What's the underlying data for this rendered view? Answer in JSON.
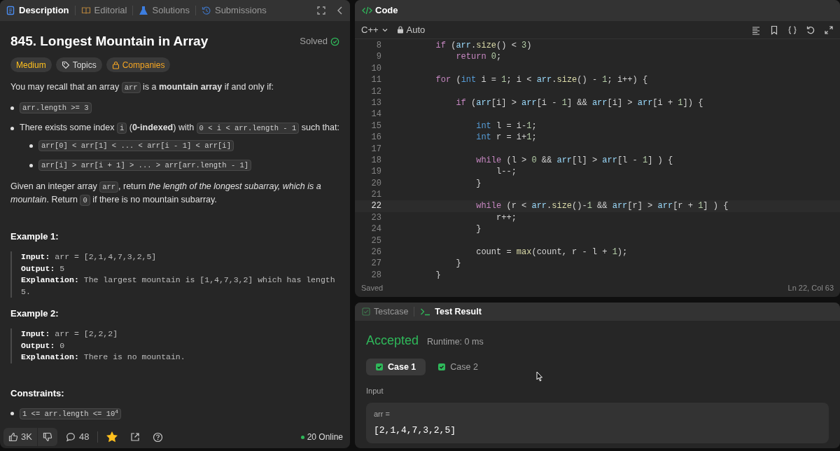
{
  "description_panel": {
    "tabs": [
      {
        "label": "Description",
        "selected": true
      },
      {
        "label": "Editorial",
        "selected": false
      },
      {
        "label": "Solutions",
        "selected": false
      },
      {
        "label": "Submissions",
        "selected": false
      }
    ],
    "title": "845. Longest Mountain in Array",
    "status": "Solved",
    "tags": [
      {
        "label": "Medium",
        "kind": "difficulty"
      },
      {
        "label": "Topics",
        "kind": "topics"
      },
      {
        "label": "Companies",
        "kind": "companies"
      }
    ],
    "intro": [
      {
        "kind": "text",
        "text": "You may recall that an array "
      },
      {
        "kind": "code",
        "text": "arr"
      },
      {
        "kind": "text",
        "text": " is a **mountain array** if and only if:"
      }
    ],
    "conditions": [
      {
        "segments": [
          {
            "kind": "code",
            "text": "arr.length >= 3"
          }
        ]
      },
      {
        "segments": [
          {
            "kind": "text",
            "text": "There exists some index "
          },
          {
            "kind": "code",
            "text": "i"
          },
          {
            "kind": "text",
            "text": " (**0-indexed**) with "
          },
          {
            "kind": "code",
            "text": "0 < i < arr.length - 1"
          },
          {
            "kind": "text",
            "text": " such that:"
          }
        ],
        "children": [
          {
            "segments": [
              {
                "kind": "code",
                "text": "arr[0] < arr[1] < ... < arr[i - 1] < arr[i]"
              }
            ]
          },
          {
            "segments": [
              {
                "kind": "code",
                "text": "arr[i] > arr[i + 1] > ... > arr[arr.length - 1]"
              }
            ]
          }
        ]
      }
    ],
    "summary": [
      {
        "kind": "text",
        "text": "Given an integer array "
      },
      {
        "kind": "code",
        "text": "arr"
      },
      {
        "kind": "text",
        "text": ", return *the length of the longest subarray, which is a mountain*. Return "
      },
      {
        "kind": "code",
        "text": "0"
      },
      {
        "kind": "text",
        "text": " if there is no mountain subarray."
      }
    ],
    "examples": [
      {
        "heading": "Example 1:",
        "lines": [
          {
            "label": "Input:",
            "value": "arr = [2,1,4,7,3,2,5]"
          },
          {
            "label": "Output:",
            "value": "5"
          },
          {
            "label": "Explanation:",
            "value": "The largest mountain is [1,4,7,3,2] which has length 5."
          }
        ]
      },
      {
        "heading": "Example 2:",
        "lines": [
          {
            "label": "Input:",
            "value": "arr = [2,2,2]"
          },
          {
            "label": "Output:",
            "value": "0"
          },
          {
            "label": "Explanation:",
            "value": "There is no mountain."
          }
        ]
      }
    ],
    "constraints": {
      "heading": "Constraints:",
      "items": [
        [
          {
            "kind": "code",
            "text": "1 <= arr.length <= 10$^{4}$"
          }
        ]
      ]
    },
    "footer": {
      "likes": "3K",
      "comments": "48",
      "starred": true,
      "online": "20 Online"
    }
  },
  "code_panel": {
    "title": "Code",
    "language": "C++",
    "mode": "Auto",
    "lines": [
      {
        "number": "8",
        "current": false,
        "tokens": [
          {
            "kind": "keyword",
            "text": "        if"
          },
          {
            "kind": "plain",
            "text": " ("
          },
          {
            "kind": "var",
            "text": "arr"
          },
          {
            "kind": "plain",
            "text": "."
          },
          {
            "kind": "func",
            "text": "size"
          },
          {
            "kind": "plain",
            "text": "() < "
          },
          {
            "kind": "num",
            "text": "3"
          },
          {
            "kind": "plain",
            "text": ")"
          }
        ]
      },
      {
        "number": "9",
        "current": false,
        "tokens": [
          {
            "kind": "keyword",
            "text": "            return "
          },
          {
            "kind": "num",
            "text": "0"
          },
          {
            "kind": "plain",
            "text": ";"
          }
        ]
      },
      {
        "number": "10",
        "current": false
      },
      {
        "number": "11",
        "current": false,
        "tokens": [
          {
            "kind": "keyword",
            "text": "        for"
          },
          {
            "kind": "plain",
            "text": " ("
          },
          {
            "kind": "type",
            "text": "int"
          },
          {
            "kind": "plain",
            "text": " i = "
          },
          {
            "kind": "num",
            "text": "1"
          },
          {
            "kind": "plain",
            "text": "; i < "
          },
          {
            "kind": "var",
            "text": "arr"
          },
          {
            "kind": "plain",
            "text": "."
          },
          {
            "kind": "func",
            "text": "size"
          },
          {
            "kind": "plain",
            "text": "() - "
          },
          {
            "kind": "num",
            "text": "1"
          },
          {
            "kind": "plain",
            "text": "; i++) {"
          }
        ]
      },
      {
        "number": "12",
        "current": false
      },
      {
        "number": "13",
        "current": false,
        "tokens": [
          {
            "kind": "keyword",
            "text": "            if"
          },
          {
            "kind": "plain",
            "text": " ("
          },
          {
            "kind": "var",
            "text": "arr"
          },
          {
            "kind": "plain",
            "text": "[i] > "
          },
          {
            "kind": "var",
            "text": "arr"
          },
          {
            "kind": "plain",
            "text": "[i - "
          },
          {
            "kind": "num",
            "text": "1"
          },
          {
            "kind": "plain",
            "text": "] && "
          },
          {
            "kind": "var",
            "text": "arr"
          },
          {
            "kind": "plain",
            "text": "[i] > "
          },
          {
            "kind": "var",
            "text": "arr"
          },
          {
            "kind": "plain",
            "text": "[i + "
          },
          {
            "kind": "num",
            "text": "1"
          },
          {
            "kind": "plain",
            "text": "]) {"
          }
        ]
      },
      {
        "number": "14",
        "current": false
      },
      {
        "number": "15",
        "current": false,
        "tokens": [
          {
            "kind": "type",
            "text": "                int"
          },
          {
            "kind": "plain",
            "text": " l = i-"
          },
          {
            "kind": "num",
            "text": "1"
          },
          {
            "kind": "plain",
            "text": ";"
          }
        ]
      },
      {
        "number": "16",
        "current": false,
        "tokens": [
          {
            "kind": "type",
            "text": "                int"
          },
          {
            "kind": "plain",
            "text": " r = i+"
          },
          {
            "kind": "num",
            "text": "1"
          },
          {
            "kind": "plain",
            "text": ";"
          }
        ]
      },
      {
        "number": "17",
        "current": false
      },
      {
        "number": "18",
        "current": false,
        "tokens": [
          {
            "kind": "keyword",
            "text": "                while"
          },
          {
            "kind": "plain",
            "text": " (l > "
          },
          {
            "kind": "num",
            "text": "0"
          },
          {
            "kind": "plain",
            "text": " && "
          },
          {
            "kind": "var",
            "text": "arr"
          },
          {
            "kind": "plain",
            "text": "[l] > "
          },
          {
            "kind": "var",
            "text": "arr"
          },
          {
            "kind": "plain",
            "text": "[l - "
          },
          {
            "kind": "num",
            "text": "1"
          },
          {
            "kind": "plain",
            "text": "] ) {"
          }
        ]
      },
      {
        "number": "19",
        "current": false,
        "tokens": [
          {
            "kind": "plain",
            "text": "                    l--;"
          }
        ]
      },
      {
        "number": "20",
        "current": false,
        "tokens": [
          {
            "kind": "plain",
            "text": "                }"
          }
        ]
      },
      {
        "number": "21",
        "current": false
      },
      {
        "number": "22",
        "current": true,
        "tokens": [
          {
            "kind": "keyword",
            "text": "                while"
          },
          {
            "kind": "plain",
            "text": " (r < "
          },
          {
            "kind": "var",
            "text": "arr"
          },
          {
            "kind": "plain",
            "text": "."
          },
          {
            "kind": "func",
            "text": "size"
          },
          {
            "kind": "plain",
            "text": "()-"
          },
          {
            "kind": "num",
            "text": "1"
          },
          {
            "kind": "plain",
            "text": " && "
          },
          {
            "kind": "var",
            "text": "arr"
          },
          {
            "kind": "plain",
            "text": "[r] > "
          },
          {
            "kind": "var",
            "text": "arr"
          },
          {
            "kind": "plain",
            "text": "[r + "
          },
          {
            "kind": "num",
            "text": "1"
          },
          {
            "kind": "plain",
            "text": "] ) {"
          }
        ]
      },
      {
        "number": "23",
        "current": false,
        "tokens": [
          {
            "kind": "plain",
            "text": "                    r++;"
          }
        ]
      },
      {
        "number": "24",
        "current": false,
        "tokens": [
          {
            "kind": "plain",
            "text": "                }"
          }
        ]
      },
      {
        "number": "25",
        "current": false
      },
      {
        "number": "26",
        "current": false,
        "tokens": [
          {
            "kind": "plain",
            "text": "                count = "
          },
          {
            "kind": "func",
            "text": "max"
          },
          {
            "kind": "plain",
            "text": "(count, r - l + "
          },
          {
            "kind": "num",
            "text": "1"
          },
          {
            "kind": "plain",
            "text": ");"
          }
        ]
      },
      {
        "number": "27",
        "current": false,
        "tokens": [
          {
            "kind": "plain",
            "text": "            }"
          }
        ]
      },
      {
        "number": "28",
        "current": false,
        "tokens": [
          {
            "kind": "plain",
            "text": "        }"
          }
        ]
      }
    ],
    "status": "Saved",
    "cursor": "Ln 22, Col 63"
  },
  "result_panel": {
    "tabs": [
      {
        "label": "Testcase",
        "selected": false
      },
      {
        "label": "Test Result",
        "selected": true
      }
    ],
    "verdict": "Accepted",
    "runtime": "Runtime: 0 ms",
    "cases": [
      {
        "label": "Case 1",
        "selected": true,
        "passed": true
      },
      {
        "label": "Case 2",
        "selected": false,
        "passed": true
      }
    ],
    "input_label": "Input",
    "inputs": [
      {
        "name": "arr =",
        "value": "[2,1,4,7,3,2,5]"
      }
    ]
  }
}
